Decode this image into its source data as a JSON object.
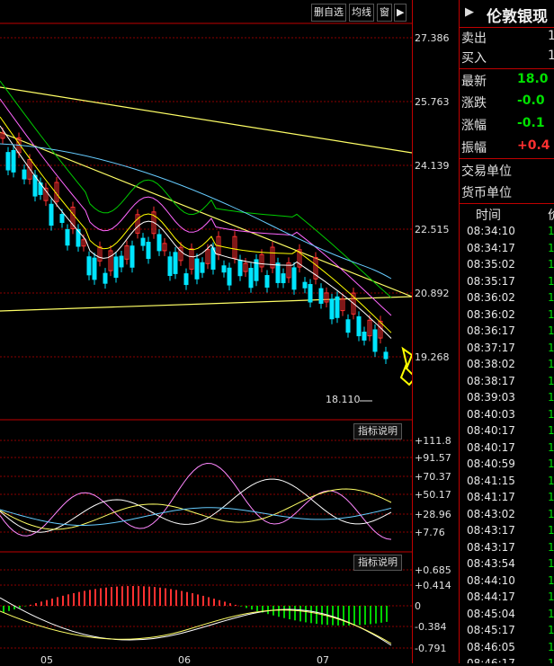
{
  "toolbar": {
    "delete_label": "删自选",
    "ma_label": "均线",
    "window_label": "窗",
    "arrow_icon": "play-icon"
  },
  "price_axis": [
    "27.386",
    "25.763",
    "24.139",
    "22.515",
    "20.892",
    "19.268"
  ],
  "min_price_label": "18.110",
  "indicator1": {
    "button_label": "指标说明",
    "axis": [
      "+111.8",
      "+91.57",
      "+70.37",
      "+50.17",
      "+28.96",
      "+7.76"
    ]
  },
  "indicator2": {
    "button_label": "指标说明",
    "axis": [
      "+0.685",
      "+0.414",
      "0",
      "-0.384",
      "-0.791"
    ]
  },
  "x_axis": [
    "05",
    "06",
    "07"
  ],
  "quote_panel": {
    "title": "伦敦银现",
    "title_icon": "play-icon",
    "rows": [
      {
        "label": "卖出",
        "value": "1",
        "color": "#e0e0e0"
      },
      {
        "label": "买入",
        "value": "1",
        "color": "#e0e0e0"
      },
      {
        "label": "最新",
        "value": "18.0",
        "color": "#00e000"
      },
      {
        "label": "涨跌",
        "value": "-0.0",
        "color": "#00e000"
      },
      {
        "label": "涨幅",
        "value": "-0.1",
        "color": "#00e000"
      },
      {
        "label": "振幅",
        "value": "+0.4",
        "color": "#ff3030"
      },
      {
        "label": "交易单位",
        "value": "",
        "color": "#e0e0e0"
      },
      {
        "label": "货币单位",
        "value": "",
        "color": "#e0e0e0"
      }
    ],
    "tick_header_time": "时间",
    "tick_header_price": "价",
    "ticks": [
      {
        "time": "08:34:10",
        "price": "1"
      },
      {
        "time": "08:34:17",
        "price": "1"
      },
      {
        "time": "08:35:02",
        "price": "1"
      },
      {
        "time": "08:35:17",
        "price": "1"
      },
      {
        "time": "08:36:02",
        "price": "1"
      },
      {
        "time": "08:36:02",
        "price": "1"
      },
      {
        "time": "08:36:17",
        "price": "1"
      },
      {
        "time": "08:37:17",
        "price": "1"
      },
      {
        "time": "08:38:02",
        "price": "1"
      },
      {
        "time": "08:38:17",
        "price": "1"
      },
      {
        "time": "08:39:03",
        "price": "1"
      },
      {
        "time": "08:40:03",
        "price": "1"
      },
      {
        "time": "08:40:17",
        "price": "1"
      },
      {
        "time": "08:40:17",
        "price": "1"
      },
      {
        "time": "08:40:59",
        "price": "1"
      },
      {
        "time": "08:41:15",
        "price": "1"
      },
      {
        "time": "08:41:17",
        "price": "1"
      },
      {
        "time": "08:43:02",
        "price": "1"
      },
      {
        "time": "08:43:17",
        "price": "1"
      },
      {
        "time": "08:43:17",
        "price": "1"
      },
      {
        "time": "08:43:54",
        "price": "1"
      },
      {
        "time": "08:44:10",
        "price": "1"
      },
      {
        "time": "08:44:17",
        "price": "1"
      },
      {
        "time": "08:45:04",
        "price": "1"
      },
      {
        "time": "08:45:17",
        "price": "1"
      },
      {
        "time": "08:46:05",
        "price": "1"
      },
      {
        "time": "08:46:17",
        "price": "1"
      }
    ]
  },
  "colors": {
    "up": "#ff3030",
    "down": "#00e5ff",
    "grid": "#8b0000",
    "trendline": "#ffff66",
    "ma1": "#ffffff",
    "ma2": "#ffff00",
    "ma3": "#ff66ff",
    "ma4": "#00cc00",
    "ma5": "#66ccff",
    "arrow": "#ffff00"
  }
}
